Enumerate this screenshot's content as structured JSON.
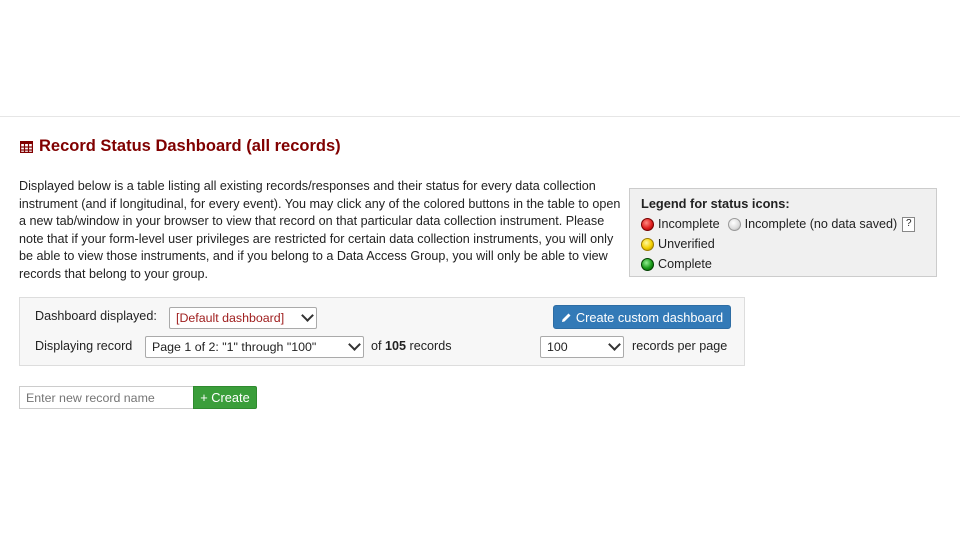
{
  "title": "Record Status Dashboard (all records)",
  "intro_text": "Displayed below is a table listing all existing records/responses and their status for every data collection instrument (and if longitudinal, for every event). You may click any of the colored buttons in the table to open a new tab/window in your browser to view that record on that particular data collection instrument. Please note that if your form-level user privileges are restricted for certain data collection instruments, you will only be able to view those instruments, and if you belong to a Data Access Group, you will only be able to view records that belong to your group.",
  "legend": {
    "title": "Legend for status icons:",
    "incomplete": "Incomplete",
    "incomplete_no_data": "Incomplete (no data saved)",
    "help": "?",
    "unverified": "Unverified",
    "complete": "Complete"
  },
  "panel": {
    "dashboard_label": "Dashboard displayed:",
    "dashboard_value": "[Default dashboard]",
    "create_custom_label": "Create custom dashboard",
    "displaying_label": "Displaying record",
    "page_value": "Page 1 of 2: \"1\" through \"100\"",
    "of_text": "of",
    "record_count": "105",
    "records_text": "records",
    "per_page_value": "100",
    "per_page_label": "records per page"
  },
  "new_record": {
    "placeholder": "Enter new record name",
    "create_label": "+ Create"
  },
  "colors": {
    "title": "#800000",
    "primary_button": "#337ab7",
    "create_button": "#3a9e3a"
  }
}
